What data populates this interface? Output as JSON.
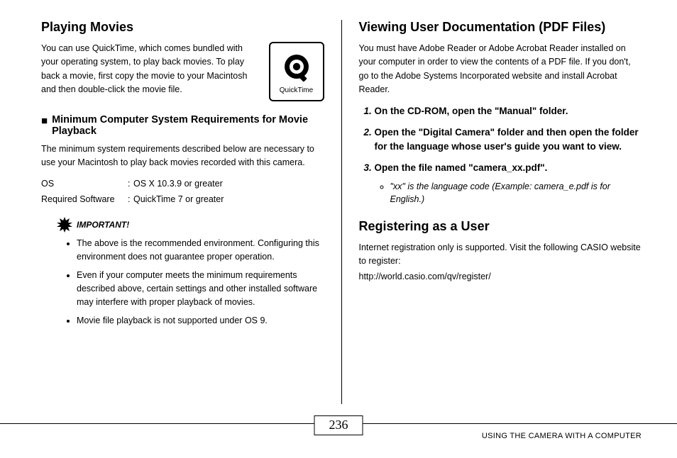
{
  "left": {
    "h1": "Playing Movies",
    "intro": "You can use QuickTime, which comes bundled with your operating system, to play back movies. To play back a movie, first copy the movie to your Macintosh and then double-click the movie file.",
    "qt_label": "QuickTime",
    "sub_h": "Minimum Computer System Requirements for Movie Playback",
    "sub_body": "The minimum system requirements described below are necessary to use your Macintosh to play back movies recorded with this camera.",
    "spec_os_key": "OS",
    "spec_os_val": "OS X 10.3.9 or greater",
    "spec_sw_key": "Required Software",
    "spec_sw_val": "QuickTime 7 or greater",
    "important_label": "IMPORTANT!",
    "bullets": [
      "The above is the recommended environment. Configuring this environment does not guarantee proper operation.",
      "Even if your computer meets the minimum requirements described above, certain settings and other installed software may interfere with proper playback of movies.",
      "Movie file playback is not supported under OS 9."
    ]
  },
  "right": {
    "h1": "Viewing User Documentation (PDF Files)",
    "intro": "You must have Adobe Reader or Adobe Acrobat Reader installed on your computer in order to view the contents of a PDF file. If you don't, go to the Adobe Systems Incorporated website and install Acrobat Reader.",
    "steps": [
      "On the CD-ROM, open the \"Manual\" folder.",
      "Open the \"Digital Camera\" folder and then open the folder for the language whose user's guide you want to view.",
      "Open the file named \"camera_xx.pdf\"."
    ],
    "step3_note": "\"xx\" is the language code (Example: camera_e.pdf is for English.)",
    "h2": "Registering as a User",
    "reg_body": "Internet registration only is supported. Visit the following CASIO website to register:",
    "reg_url": "http://world.casio.com/qv/register/"
  },
  "footer": {
    "page_num": "236",
    "text": "USING THE CAMERA WITH A COMPUTER"
  }
}
